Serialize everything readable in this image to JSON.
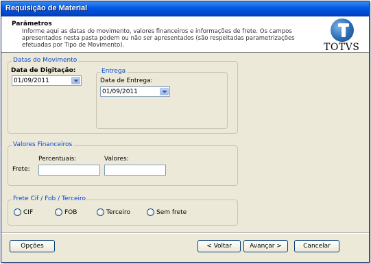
{
  "window": {
    "title": "Requisição de Material"
  },
  "header": {
    "title": "Parâmetros",
    "description": "Informe aqui as datas do movimento, valores financeiros e informações de frete. Os campos apresentados nesta pasta podem ou não ser apresentados (são respeitadas parametrizações efetuadas por Tipo de Movimento).",
    "logo_text": "TOTVS"
  },
  "datas": {
    "legend": "Datas do Movimento",
    "digitacao_label": "Data de Digitação:",
    "digitacao_value": "01/09/2011",
    "entrega_group": "Entrega",
    "entrega_label": "Data de Entrega:",
    "entrega_value": "01/09/2011"
  },
  "financeiros": {
    "legend": "Valores Financeiros",
    "percentuais_label": "Percentuais:",
    "valores_label": "Valores:",
    "frete_label": "Frete:",
    "percentuais_value": "",
    "valores_value": ""
  },
  "frete": {
    "legend": "Frete Cif / Fob / Terceiro",
    "options": [
      "CIF",
      "FOB",
      "Terceiro",
      "Sem frete"
    ]
  },
  "buttons": {
    "opcoes": "Opções",
    "voltar": "< Voltar",
    "avancar": "Avançar >",
    "cancelar": "Cancelar"
  },
  "colors": {
    "title_bar": "#0058e6",
    "legend": "#0046d5",
    "window_bg": "#ece9d8"
  }
}
